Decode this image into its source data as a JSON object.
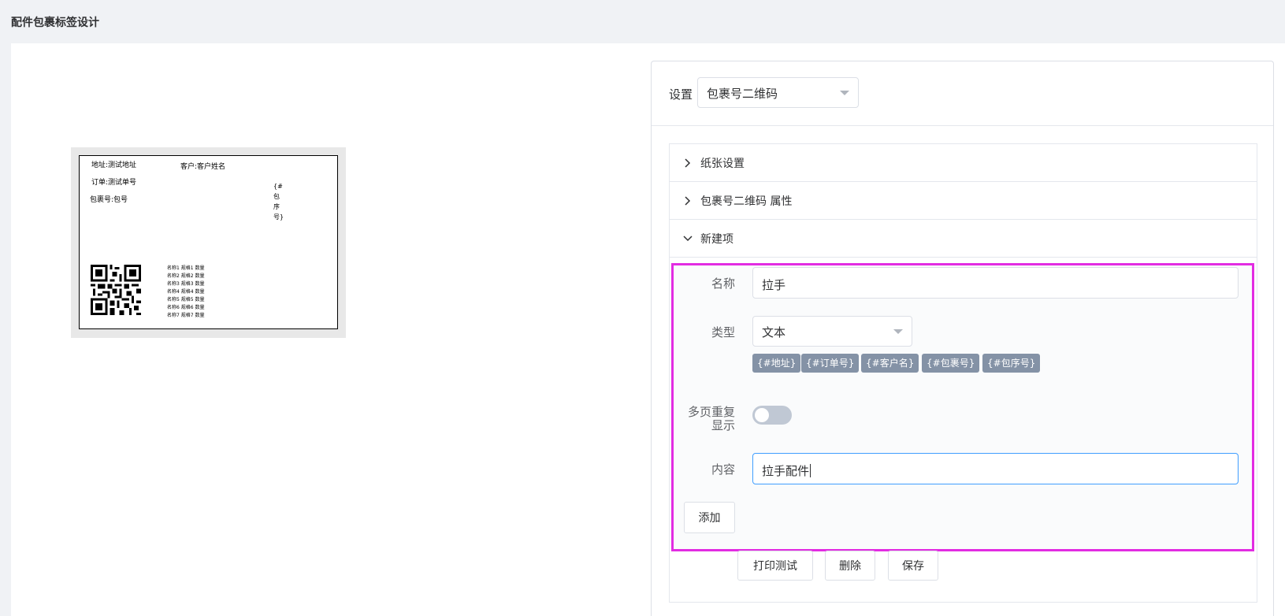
{
  "page": {
    "title": "配件包裹标签设计"
  },
  "preview": {
    "address": "地址:测试地址",
    "customer": "客户:客户姓名",
    "order": "订单:测试单号",
    "package": "包裹号:包号",
    "sequence_vertical": "{#包序号}",
    "items": [
      "名称1 规格1 数量",
      "名称2 规格2 数量",
      "名称3 规格3 数量",
      "名称4 规格4 数量",
      "名称5 规格5 数量",
      "名称6 规格6 数量",
      "名称7 规格7 数量"
    ]
  },
  "settings": {
    "label": "设置",
    "selected": "包裹号二维码"
  },
  "collapse": {
    "paper": "纸张设置",
    "properties": "包裹号二维码 属性",
    "new_item": "新建项"
  },
  "form": {
    "name_label": "名称",
    "name_value": "拉手",
    "type_label": "类型",
    "type_value": "文本",
    "tags": [
      "{#地址}",
      "{#订单号}",
      "{#客户名}",
      "{#包裹号}",
      "{#包序号}"
    ],
    "repeat_label_line1": "多页重复",
    "repeat_label_line2": "显示",
    "repeat_on": false,
    "content_label": "内容",
    "content_value": "拉手配件",
    "add_button": "添加"
  },
  "actions": {
    "print_test": "打印测试",
    "delete": "删除",
    "save": "保存"
  },
  "colors": {
    "highlight": "#e22ce2",
    "tag_bg": "#8492a6",
    "focus": "#409eff"
  }
}
